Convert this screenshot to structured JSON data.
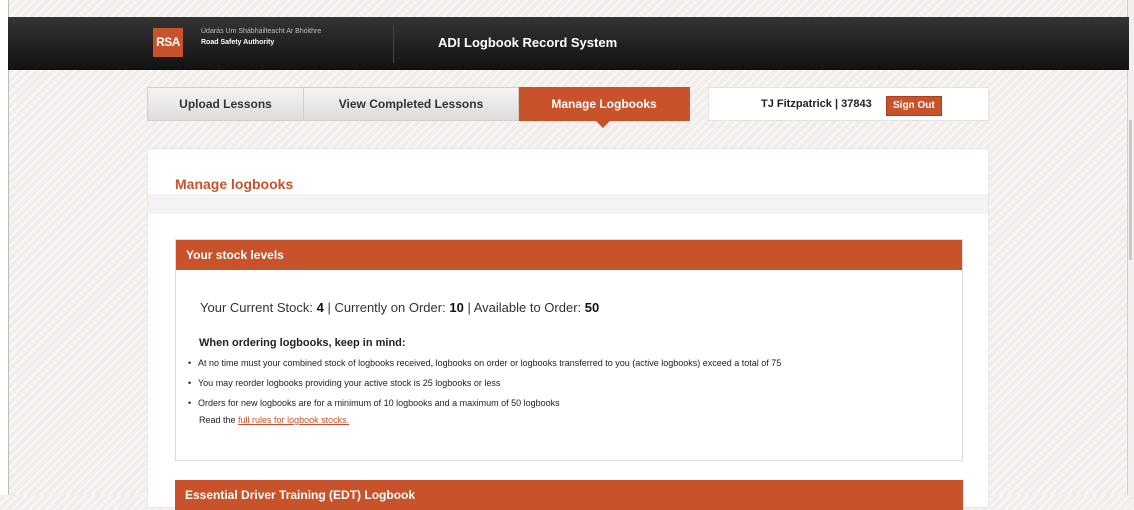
{
  "header": {
    "logo_abbr": "RSA",
    "logo_line1": "Údarás Um Shábháilteacht Ar Bhóithre",
    "logo_line2": "Road Safety Authority",
    "app_title": "ADI Logbook Record System"
  },
  "tabs": [
    {
      "label": "Upload Lessons",
      "active": false
    },
    {
      "label": "View Completed Lessons",
      "active": false
    },
    {
      "label": "Manage Logbooks",
      "active": true
    }
  ],
  "user": {
    "name": "TJ Fitzpatrick | 37843",
    "signout_label": "Sign Out"
  },
  "page": {
    "title": "Manage logbooks"
  },
  "stock": {
    "heading": "Your stock levels",
    "current_label": "Your Current Stock:",
    "current_value": "4",
    "order_label": "| Currently on Order:",
    "order_value": "10",
    "available_label": "| Available to Order:",
    "available_value": "50",
    "keep_in_mind": "When ordering logbooks, keep in mind:",
    "rules": [
      "At no time must your combined stock of logbooks received, logbooks on order or logbooks transferred to you (active logbooks) exceed a total of 75",
      "You may reorder logbooks providing your active stock is 25 logbooks or less",
      "Orders for new logbooks are for a minimum of 10 logbooks and a maximum of 50 logbooks"
    ],
    "read_prefix": "Read the",
    "read_link": "full rules for logbook stocks."
  },
  "edt": {
    "heading": "Essential Driver Training (EDT) Logbook"
  },
  "colors": {
    "accent": "#c8532b",
    "header_bg": "#1f1f1f"
  }
}
